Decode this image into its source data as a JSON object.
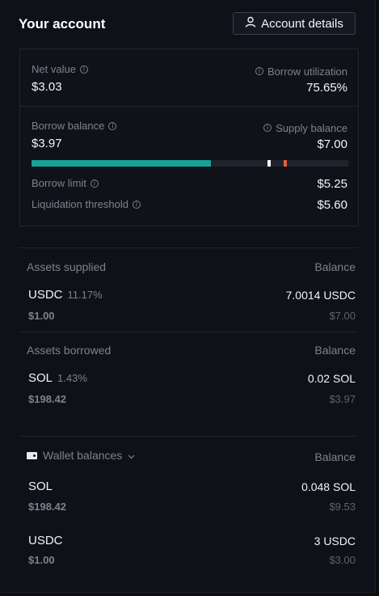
{
  "header": {
    "title": "Your account",
    "details_label": "Account details"
  },
  "summary": {
    "net_value_label": "Net value",
    "net_value": "$3.03",
    "borrow_util_label": "Borrow utilization",
    "borrow_util": "75.65%",
    "borrow_balance_label": "Borrow balance",
    "borrow_balance": "$3.97",
    "supply_balance_label": "Supply balance",
    "supply_balance": "$7.00",
    "bar": {
      "fill_fraction": 0.567,
      "limit_fraction": 0.75,
      "liq_fraction": 0.8,
      "fill_color": "#14a396",
      "limit_color": "#ffffff",
      "liq_color": "#e8603c"
    },
    "borrow_limit_label": "Borrow limit",
    "borrow_limit": "$5.25",
    "liq_threshold_label": "Liquidation threshold",
    "liq_threshold": "$5.60"
  },
  "supplied": {
    "heading": "Assets supplied",
    "balance_heading": "Balance",
    "items": [
      {
        "symbol": "USDC",
        "pct": "11.17%",
        "price": "$1.00",
        "balance": "7.0014 USDC",
        "usd": "$7.00"
      }
    ]
  },
  "borrowed": {
    "heading": "Assets borrowed",
    "balance_heading": "Balance",
    "items": [
      {
        "symbol": "SOL",
        "pct": "1.43%",
        "price": "$198.42",
        "balance": "0.02 SOL",
        "usd": "$3.97"
      }
    ]
  },
  "wallet": {
    "heading": "Wallet balances",
    "balance_heading": "Balance",
    "items": [
      {
        "symbol": "SOL",
        "price": "$198.42",
        "balance": "0.048 SOL",
        "usd": "$9.53"
      },
      {
        "symbol": "USDC",
        "price": "$1.00",
        "balance": "3 USDC",
        "usd": "$3.00"
      }
    ]
  },
  "colors": {
    "accent": "#14a396",
    "background": "#0e1117"
  },
  "icons": {
    "info": "info-icon",
    "user": "user-icon",
    "wallet": "wallet-icon",
    "chevron": "chevron-down-icon"
  }
}
